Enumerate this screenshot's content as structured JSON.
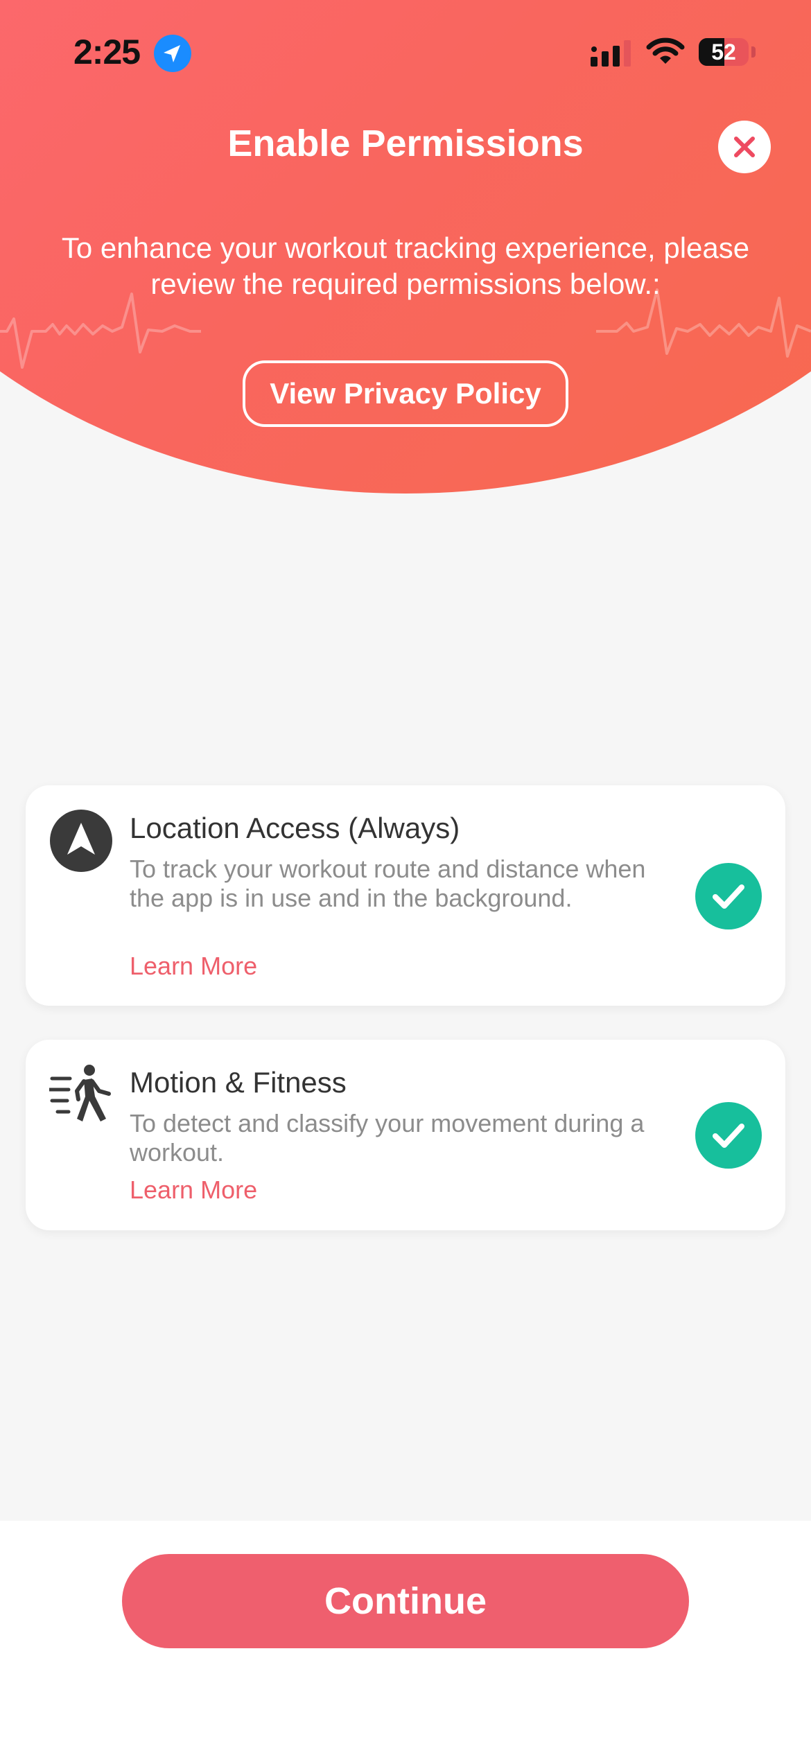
{
  "status_bar": {
    "time": "2:25",
    "battery_level": "52",
    "icons": [
      "location-arrow-icon",
      "cellular-signal-icon",
      "wifi-icon",
      "battery-icon"
    ]
  },
  "header": {
    "title": "Enable Permissions",
    "subtitle": "To enhance your workout tracking experience, please review the required permissions below.:",
    "privacy_button": "View Privacy Policy",
    "close_icon": "close-icon"
  },
  "permissions": [
    {
      "icon": "navigation-arrow-icon",
      "title": "Location Access (Always)",
      "description": "To track your workout route and distance when the app is in use and in the background.",
      "link": "Learn More",
      "granted": true
    },
    {
      "icon": "running-person-icon",
      "title": "Motion & Fitness",
      "description": "To detect and classify your movement during a workout.",
      "link": "Learn More",
      "granted": true
    }
  ],
  "footer": {
    "continue_label": "Continue"
  },
  "colors": {
    "brand": "#F9665F",
    "accent_link": "#EE5F6B",
    "granted": "#17BF9C",
    "button": "#EF5F6E",
    "background": "#F6F6F6"
  }
}
